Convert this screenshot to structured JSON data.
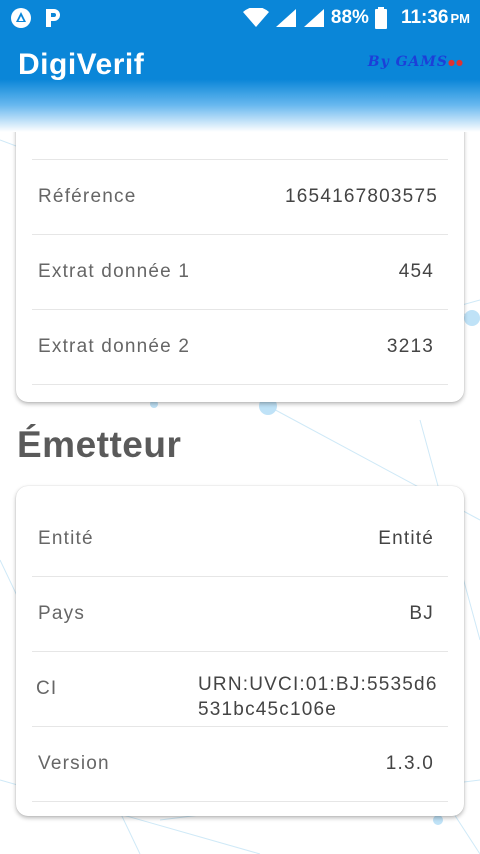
{
  "status_bar": {
    "battery": "88%",
    "time": "11:36",
    "ampm": "PM"
  },
  "app_bar": {
    "title": "DigiVerif",
    "by_logo": "By GAMS"
  },
  "document_card": {
    "rows": [
      {
        "label": "Référence",
        "value": "1654167803575"
      },
      {
        "label": "Extrat donnée 1",
        "value": "454"
      },
      {
        "label": "Extrat donnée 2",
        "value": "3213"
      }
    ]
  },
  "emitter": {
    "title": "Émetteur",
    "rows": [
      {
        "label": "Entité",
        "value": "Entité"
      },
      {
        "label": "Pays",
        "value": "BJ"
      },
      {
        "label": "CI",
        "value": "URN:UVCI:01:BJ:5535d6531bc45c106e"
      },
      {
        "label": "Version",
        "value": "1.3.0"
      }
    ]
  },
  "colors": {
    "primary": "#0a86d8",
    "logo": "#1c3fd8"
  }
}
